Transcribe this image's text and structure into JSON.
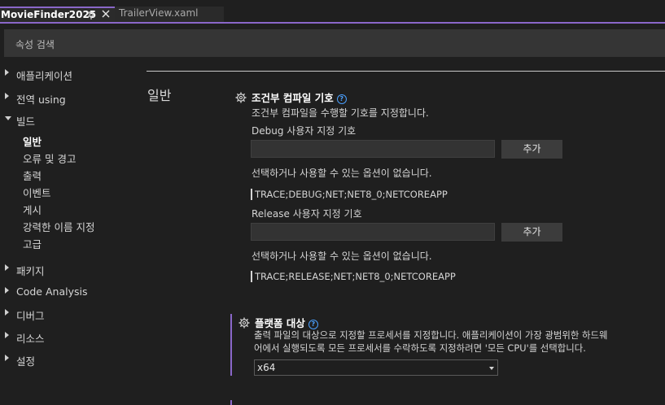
{
  "tabs": [
    {
      "title": "MovieFinder2025",
      "active": true
    },
    {
      "title": "TrailerView.xaml",
      "active": false
    }
  ],
  "search": {
    "placeholder": "속성 검색"
  },
  "sidebar": {
    "items": [
      {
        "label": "애플리케이션",
        "expanded": false
      },
      {
        "label": "전역 using",
        "expanded": false
      },
      {
        "label": "빌드",
        "expanded": true,
        "children": [
          "일반",
          "오류 및 경고",
          "출력",
          "이벤트",
          "게시",
          "강력한 이름 지정",
          "고급"
        ]
      },
      {
        "label": "패키지",
        "expanded": false
      },
      {
        "label": "Code Analysis",
        "expanded": false
      },
      {
        "label": "디버그",
        "expanded": false
      },
      {
        "label": "리소스",
        "expanded": false
      },
      {
        "label": "설정",
        "expanded": false
      }
    ],
    "selected": "일반"
  },
  "main": {
    "section_title": "일반",
    "conditional": {
      "heading": "조건부 컴파일 기호",
      "description": "조건부 컴파일을 수행할 기호를 지정합니다.",
      "debug": {
        "label": "Debug 사용자 지정 기호",
        "input_value": "",
        "add_label": "추가",
        "no_options": "선택하거나 사용할 수 있는 옵션이 없습니다.",
        "constants": "TRACE;DEBUG;NET;NET8_0;NETCOREAPP"
      },
      "release": {
        "label": "Release 사용자 지정 기호",
        "input_value": "",
        "add_label": "추가",
        "no_options": "선택하거나 사용할 수 있는 옵션이 없습니다.",
        "constants": "TRACE;RELEASE;NET;NET8_0;NETCOREAPP"
      }
    },
    "platform": {
      "heading": "플랫폼 대상",
      "description_line1": "출력 파일의 대상으로 지정할 프로세서를 지정합니다. 애플리케이션이 가장 광범위한 하드웨",
      "description_line2": "어에서 실행되도록 모든 프로세서를 수락하도록 지정하려면 '모든 CPU'를 선택합니다.",
      "selected": "x64"
    }
  },
  "icons": {
    "help": "help-circle-icon",
    "settings": "gear-icon",
    "pin": "pin-icon",
    "close": "close-icon"
  },
  "colors": {
    "accent": "#8a67c9",
    "help": "#4aa0ff",
    "background": "#1f1f1f"
  }
}
